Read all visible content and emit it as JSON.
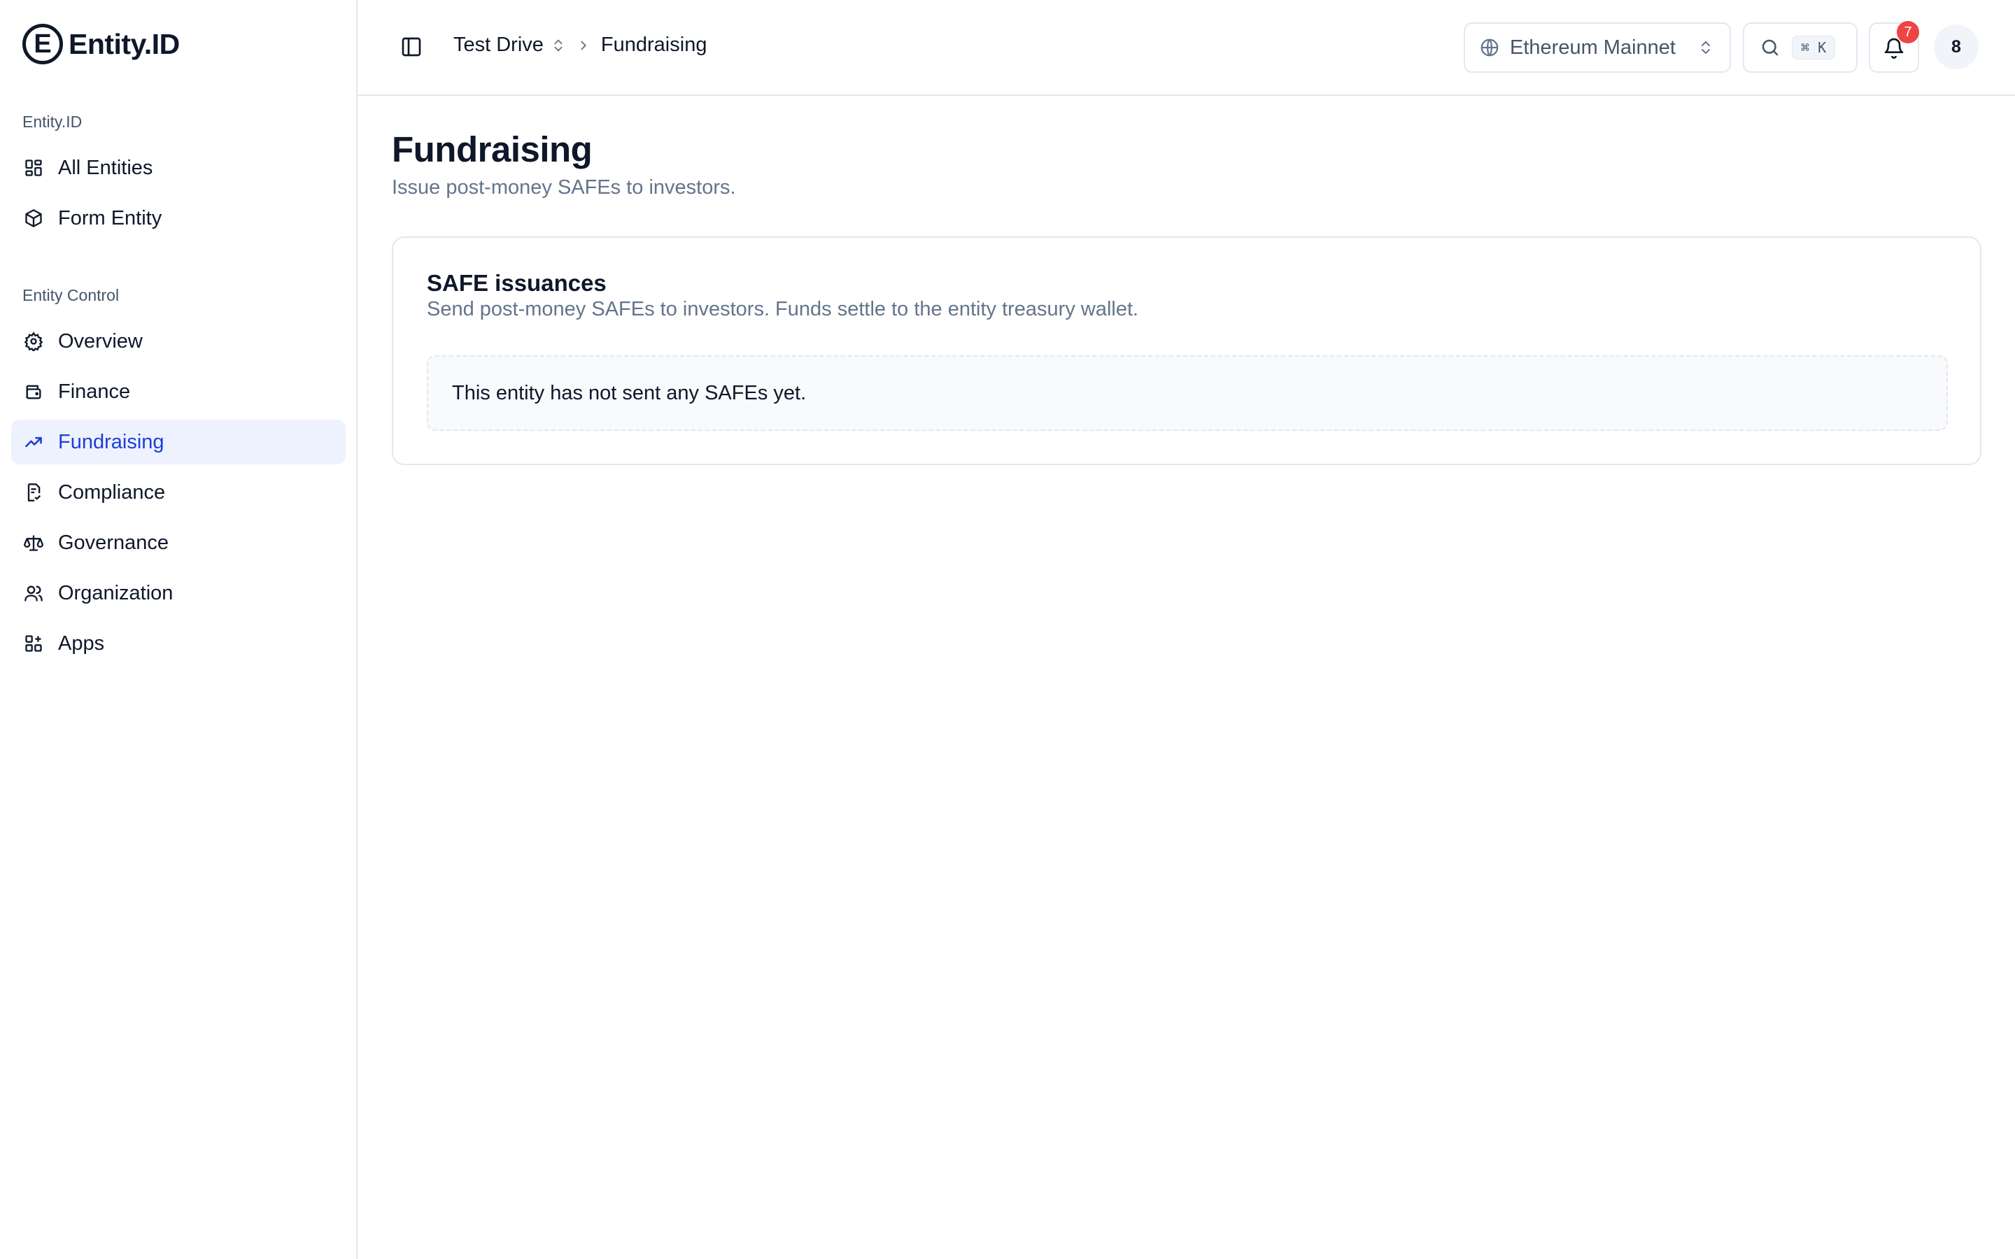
{
  "brand": {
    "mark": "E",
    "name": "Entity.ID"
  },
  "sidebar": {
    "sections": [
      {
        "label": "Entity.ID",
        "items": [
          {
            "label": "All Entities",
            "icon": "grid-icon"
          },
          {
            "label": "Form Entity",
            "icon": "box-icon"
          }
        ]
      },
      {
        "label": "Entity Control",
        "items": [
          {
            "label": "Overview",
            "icon": "gear-icon"
          },
          {
            "label": "Finance",
            "icon": "wallet-icon"
          },
          {
            "label": "Fundraising",
            "icon": "trending-up-icon",
            "active": true
          },
          {
            "label": "Compliance",
            "icon": "document-check-icon"
          },
          {
            "label": "Governance",
            "icon": "scale-icon"
          },
          {
            "label": "Organization",
            "icon": "users-icon"
          },
          {
            "label": "Apps",
            "icon": "apps-icon"
          }
        ]
      }
    ]
  },
  "topbar": {
    "entity": "Test Drive",
    "current": "Fundraising",
    "network": "Ethereum Mainnet",
    "search_shortcut": "⌘ K",
    "notifications_count": "7",
    "avatar": "8"
  },
  "page": {
    "title": "Fundraising",
    "subtitle": "Issue post-money SAFEs to investors."
  },
  "card": {
    "title": "SAFE issuances",
    "description": "Send post-money SAFEs to investors. Funds settle to the entity treasury wallet.",
    "empty_message": "This entity has not sent any SAFEs yet."
  },
  "colors": {
    "accent": "#1d3fd6",
    "active_bg": "#eef2ff",
    "badge": "#ef4444"
  }
}
